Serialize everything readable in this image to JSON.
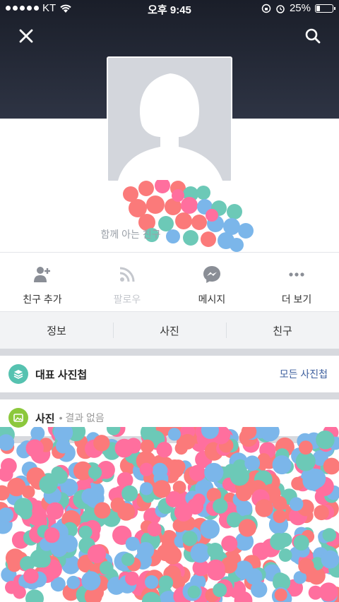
{
  "status_bar": {
    "carrier": "KT",
    "time": "오후 9:45",
    "battery": "25%",
    "battery_level": 0.25
  },
  "header": {
    "close_icon": "close-icon",
    "search_icon": "search-icon"
  },
  "profile": {
    "mutual_friends": "함께 아는 친구"
  },
  "actions": [
    {
      "label": "친구 추가",
      "icon": "add-friend-icon"
    },
    {
      "label": "팔로우",
      "icon": "rss-icon"
    },
    {
      "label": "메시지",
      "icon": "messenger-icon"
    },
    {
      "label": "더 보기",
      "icon": "more-icon"
    }
  ],
  "tabs": [
    {
      "label": "정보"
    },
    {
      "label": "사진"
    },
    {
      "label": "친구"
    }
  ],
  "featured_album": {
    "title": "대표 사진첩",
    "link": "모든 사진첩",
    "icon_color": "#56c2b0"
  },
  "photos_section": {
    "title": "사진",
    "sub": "결과 없음",
    "icon_color": "#8cc83c"
  },
  "colors": {
    "header_bg": "#1f2330",
    "link": "#3d5f9e",
    "gray_text": "#9aa0a8"
  }
}
